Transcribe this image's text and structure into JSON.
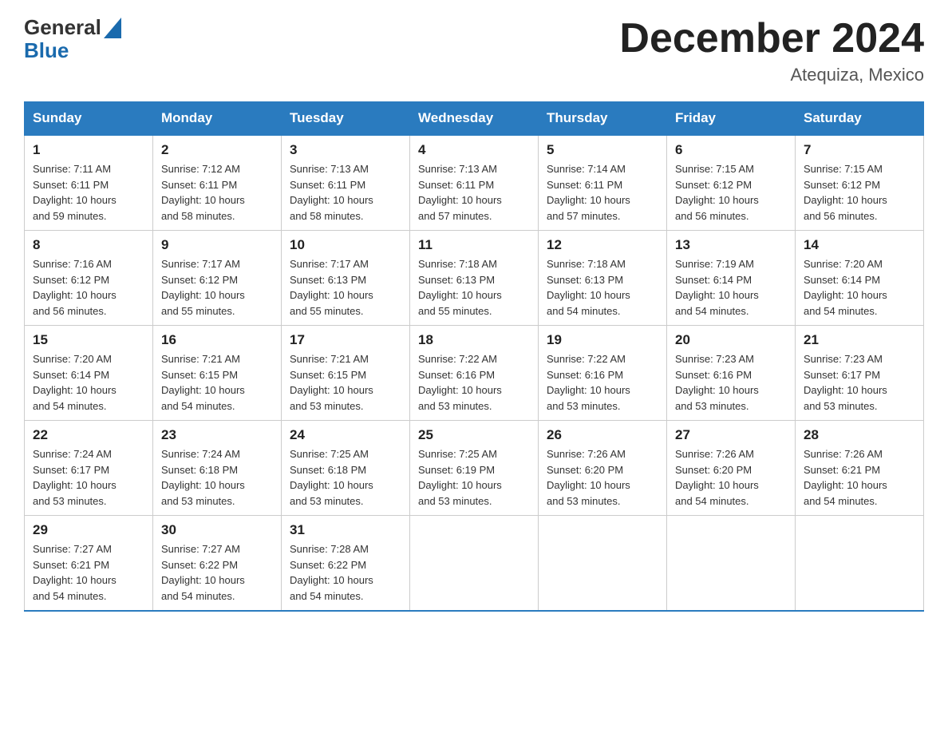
{
  "header": {
    "logo": {
      "general": "General",
      "blue": "Blue"
    },
    "title": "December 2024",
    "location": "Atequiza, Mexico"
  },
  "days_of_week": [
    "Sunday",
    "Monday",
    "Tuesday",
    "Wednesday",
    "Thursday",
    "Friday",
    "Saturday"
  ],
  "weeks": [
    [
      {
        "day": "1",
        "sunrise": "7:11 AM",
        "sunset": "6:11 PM",
        "daylight": "10 hours and 59 minutes."
      },
      {
        "day": "2",
        "sunrise": "7:12 AM",
        "sunset": "6:11 PM",
        "daylight": "10 hours and 58 minutes."
      },
      {
        "day": "3",
        "sunrise": "7:13 AM",
        "sunset": "6:11 PM",
        "daylight": "10 hours and 58 minutes."
      },
      {
        "day": "4",
        "sunrise": "7:13 AM",
        "sunset": "6:11 PM",
        "daylight": "10 hours and 57 minutes."
      },
      {
        "day": "5",
        "sunrise": "7:14 AM",
        "sunset": "6:11 PM",
        "daylight": "10 hours and 57 minutes."
      },
      {
        "day": "6",
        "sunrise": "7:15 AM",
        "sunset": "6:12 PM",
        "daylight": "10 hours and 56 minutes."
      },
      {
        "day": "7",
        "sunrise": "7:15 AM",
        "sunset": "6:12 PM",
        "daylight": "10 hours and 56 minutes."
      }
    ],
    [
      {
        "day": "8",
        "sunrise": "7:16 AM",
        "sunset": "6:12 PM",
        "daylight": "10 hours and 56 minutes."
      },
      {
        "day": "9",
        "sunrise": "7:17 AM",
        "sunset": "6:12 PM",
        "daylight": "10 hours and 55 minutes."
      },
      {
        "day": "10",
        "sunrise": "7:17 AM",
        "sunset": "6:13 PM",
        "daylight": "10 hours and 55 minutes."
      },
      {
        "day": "11",
        "sunrise": "7:18 AM",
        "sunset": "6:13 PM",
        "daylight": "10 hours and 55 minutes."
      },
      {
        "day": "12",
        "sunrise": "7:18 AM",
        "sunset": "6:13 PM",
        "daylight": "10 hours and 54 minutes."
      },
      {
        "day": "13",
        "sunrise": "7:19 AM",
        "sunset": "6:14 PM",
        "daylight": "10 hours and 54 minutes."
      },
      {
        "day": "14",
        "sunrise": "7:20 AM",
        "sunset": "6:14 PM",
        "daylight": "10 hours and 54 minutes."
      }
    ],
    [
      {
        "day": "15",
        "sunrise": "7:20 AM",
        "sunset": "6:14 PM",
        "daylight": "10 hours and 54 minutes."
      },
      {
        "day": "16",
        "sunrise": "7:21 AM",
        "sunset": "6:15 PM",
        "daylight": "10 hours and 54 minutes."
      },
      {
        "day": "17",
        "sunrise": "7:21 AM",
        "sunset": "6:15 PM",
        "daylight": "10 hours and 53 minutes."
      },
      {
        "day": "18",
        "sunrise": "7:22 AM",
        "sunset": "6:16 PM",
        "daylight": "10 hours and 53 minutes."
      },
      {
        "day": "19",
        "sunrise": "7:22 AM",
        "sunset": "6:16 PM",
        "daylight": "10 hours and 53 minutes."
      },
      {
        "day": "20",
        "sunrise": "7:23 AM",
        "sunset": "6:16 PM",
        "daylight": "10 hours and 53 minutes."
      },
      {
        "day": "21",
        "sunrise": "7:23 AM",
        "sunset": "6:17 PM",
        "daylight": "10 hours and 53 minutes."
      }
    ],
    [
      {
        "day": "22",
        "sunrise": "7:24 AM",
        "sunset": "6:17 PM",
        "daylight": "10 hours and 53 minutes."
      },
      {
        "day": "23",
        "sunrise": "7:24 AM",
        "sunset": "6:18 PM",
        "daylight": "10 hours and 53 minutes."
      },
      {
        "day": "24",
        "sunrise": "7:25 AM",
        "sunset": "6:18 PM",
        "daylight": "10 hours and 53 minutes."
      },
      {
        "day": "25",
        "sunrise": "7:25 AM",
        "sunset": "6:19 PM",
        "daylight": "10 hours and 53 minutes."
      },
      {
        "day": "26",
        "sunrise": "7:26 AM",
        "sunset": "6:20 PM",
        "daylight": "10 hours and 53 minutes."
      },
      {
        "day": "27",
        "sunrise": "7:26 AM",
        "sunset": "6:20 PM",
        "daylight": "10 hours and 54 minutes."
      },
      {
        "day": "28",
        "sunrise": "7:26 AM",
        "sunset": "6:21 PM",
        "daylight": "10 hours and 54 minutes."
      }
    ],
    [
      {
        "day": "29",
        "sunrise": "7:27 AM",
        "sunset": "6:21 PM",
        "daylight": "10 hours and 54 minutes."
      },
      {
        "day": "30",
        "sunrise": "7:27 AM",
        "sunset": "6:22 PM",
        "daylight": "10 hours and 54 minutes."
      },
      {
        "day": "31",
        "sunrise": "7:28 AM",
        "sunset": "6:22 PM",
        "daylight": "10 hours and 54 minutes."
      },
      null,
      null,
      null,
      null
    ]
  ],
  "labels": {
    "sunrise": "Sunrise:",
    "sunset": "Sunset:",
    "daylight": "Daylight:"
  }
}
